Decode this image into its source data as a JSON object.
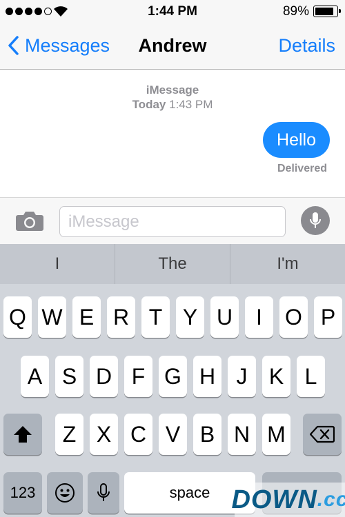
{
  "status_bar": {
    "time": "1:44 PM",
    "battery_percent": "89%",
    "battery_level": 0.89,
    "signal_bars_filled": 4,
    "signal_bars_total": 5
  },
  "nav": {
    "back_label": "Messages",
    "title": "Andrew",
    "details_label": "Details"
  },
  "conversation": {
    "service_label": "iMessage",
    "timestamp_day": "Today",
    "timestamp_time": "1:43 PM",
    "messages": [
      {
        "text": "Hello",
        "from_me": true,
        "status": "Delivered"
      }
    ]
  },
  "input": {
    "placeholder": "iMessage",
    "value": ""
  },
  "suggestions": [
    "I",
    "The",
    "I'm"
  ],
  "keyboard": {
    "row1": [
      "Q",
      "W",
      "E",
      "R",
      "T",
      "Y",
      "U",
      "I",
      "O",
      "P"
    ],
    "row2": [
      "A",
      "S",
      "D",
      "F",
      "G",
      "H",
      "J",
      "K",
      "L"
    ],
    "row3": [
      "Z",
      "X",
      "C",
      "V",
      "B",
      "N",
      "M"
    ],
    "numbers_label": "123",
    "space_label": "space"
  },
  "watermark": {
    "main": "DOWN",
    "suffix": ".cc"
  },
  "colors": {
    "accent": "#157efb",
    "bubble": "#1a8cff",
    "keyboard_bg": "#d1d5db",
    "secondary_text": "#8e8e93"
  }
}
